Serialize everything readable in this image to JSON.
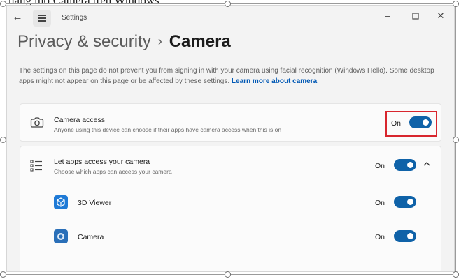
{
  "window": {
    "app_title": "Settings",
    "back_icon": "arrow-left-icon",
    "menu_icon": "hamburger-menu-icon",
    "controls": {
      "minimize": "minimize-icon",
      "maximize": "maximize-icon",
      "close": "close-icon"
    }
  },
  "breadcrumb": {
    "parent": "Privacy & security",
    "separator": "›",
    "current": "Camera"
  },
  "info": {
    "text": "The settings on this page do not prevent you from signing in with your camera using facial recognition (Windows Hello). Some desktop apps might not appear on this page or be affected by these settings.",
    "link": "Learn more about camera"
  },
  "camera_access": {
    "icon": "camera-icon",
    "title": "Camera access",
    "description": "Anyone using this device can choose if their apps have camera access when this is on",
    "state": "On",
    "toggle_on": true
  },
  "let_apps": {
    "icon": "list-icon",
    "title": "Let apps access your camera",
    "description": "Choose which apps can access your camera",
    "state": "On",
    "toggle_on": true,
    "expanded_icon": "chevron-up-icon"
  },
  "apps": [
    {
      "name": "3D Viewer",
      "icon": "3d-cube-icon",
      "state": "On",
      "toggle_on": true
    },
    {
      "name": "Camera",
      "icon": "camera-app-icon",
      "state": "On",
      "toggle_on": true
    }
  ],
  "colors": {
    "accent": "#0f62a8",
    "highlight": "#d8262e",
    "link": "#0058b4"
  },
  "doc_caption": "nắng mở Camera trên Windows."
}
